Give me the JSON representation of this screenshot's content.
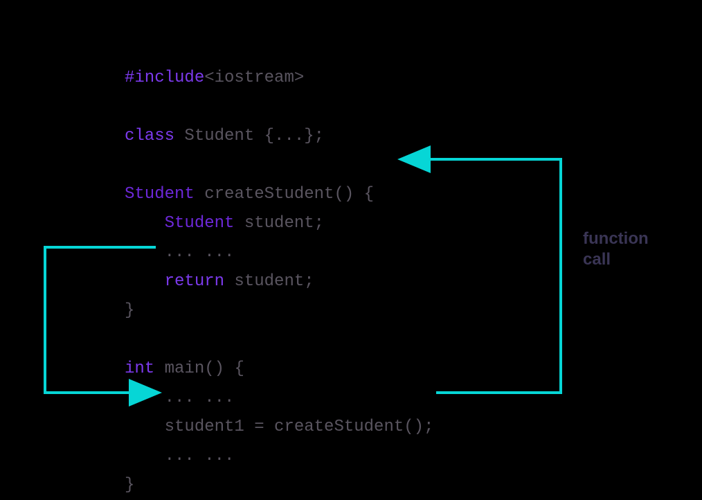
{
  "code": {
    "line1_include": "#include",
    "line1_header": "<iostream>",
    "line3_class": "class",
    "line3_name": " Student ",
    "line3_body": "{...};",
    "line5_type": "Student",
    "line5_func": " createStudent() {",
    "line6_indent": "    ",
    "line6_type": "Student",
    "line6_var": " student;",
    "line7_indent": "    ",
    "line7_dots": "... ...",
    "line8_indent": "    ",
    "line8_return": "return",
    "line8_var": " student;",
    "line9_close": "}",
    "line11_int": "int",
    "line11_main": " main() {",
    "line12_indent": "    ",
    "line12_dots": "... ...",
    "line13_indent": "    ",
    "line13_stmt": "student1 = createStudent();",
    "line14_indent": "    ",
    "line14_dots": "... ...",
    "line15_close": "}"
  },
  "annotation": {
    "label_line1": "function",
    "label_line2": "call"
  },
  "colors": {
    "arrow": "#06d6d6",
    "keyword_purple": "#7c3aed",
    "keyword_blue": "#6d28d9",
    "text_gray": "#5a5560",
    "annotation_color": "#3a3555",
    "background": "#000000"
  }
}
